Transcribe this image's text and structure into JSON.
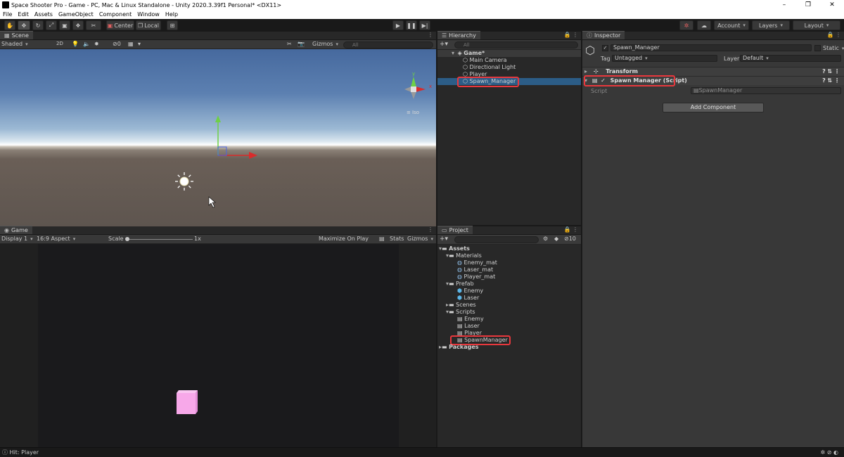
{
  "window": {
    "title": "Space Shooter Pro - Game - PC, Mac & Linux Standalone - Unity 2020.3.39f1 Personal* <DX11>",
    "controls": [
      "–",
      "❐",
      "✕"
    ]
  },
  "menu": [
    "File",
    "Edit",
    "Assets",
    "GameObject",
    "Component",
    "Window",
    "Help"
  ],
  "toolbar": {
    "pivot": "Center",
    "space": "Local",
    "right": {
      "account": "Account",
      "layers": "Layers",
      "layout": "Layout"
    }
  },
  "scene": {
    "tab": "Scene",
    "shading": "Shaded",
    "mode2d": "2D",
    "fx_count": "0",
    "gizmos": "Gizmos",
    "search_placeholder": "All",
    "orientation": {
      "y": "y",
      "x": "x",
      "iso": "Iso"
    }
  },
  "game": {
    "tab": "Game",
    "display": "Display 1",
    "aspect": "16:9 Aspect",
    "scale_label": "Scale",
    "scale_value": "1x",
    "maximize": "Maximize On Play",
    "stats": "Stats",
    "gizmos": "Gizmos"
  },
  "hierarchy": {
    "tab": "Hierarchy",
    "search_placeholder": "All",
    "scene": "Game*",
    "items": [
      "Main Camera",
      "Directional Light",
      "Player",
      "Spawn_Manager"
    ]
  },
  "project": {
    "tab": "Project",
    "count": "10",
    "assets": "Assets",
    "materials": "Materials",
    "material_items": [
      "Enemy_mat",
      "Laser_mat",
      "Player_mat"
    ],
    "prefab": "Prefab",
    "prefab_items": [
      "Enemy",
      "Laser"
    ],
    "scenes": "Scenes",
    "scripts": "Scripts",
    "script_items": [
      "Enemy",
      "Laser",
      "Player",
      "SpawnManager"
    ],
    "packages": "Packages"
  },
  "inspector": {
    "tab": "Inspector",
    "object_name": "Spawn_Manager",
    "static": "Static",
    "tag_label": "Tag",
    "tag_value": "Untagged",
    "layer_label": "Layer",
    "layer_value": "Default",
    "transform": "Transform",
    "script_component": "Spawn Manager (Script)",
    "script_label": "Script",
    "script_value": "SpawnManager",
    "add_component": "Add Component"
  },
  "status": {
    "message": "Hit: Player"
  },
  "colors": {
    "selection": "#2c5d87",
    "highlight": "#e8383d",
    "cube": "#f7a8e9"
  }
}
